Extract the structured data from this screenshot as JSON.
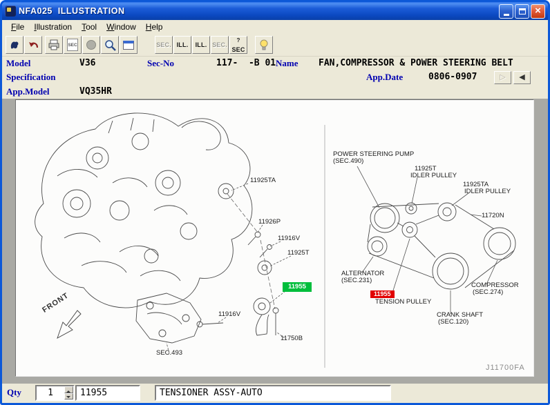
{
  "window": {
    "title": "NFA025  ILLUSTRATION"
  },
  "menu": {
    "items": [
      "File",
      "Illustration",
      "Tool",
      "Window",
      "Help"
    ]
  },
  "toolbar": {
    "sec_doc_label": "SEC",
    "sec_disabled_1": "SEC.",
    "ill_1": "ILL.",
    "ill_2": "ILL.",
    "sec_disabled_2": "SEC.",
    "sec_query_label": "SEC",
    "sec_query_badge": "?"
  },
  "info": {
    "model_label": "Model",
    "model_value": "V36",
    "secno_label": "Sec-No",
    "secno_value": "117-  -B 01",
    "name_label": "Name",
    "name_value": "FAN,COMPRESSOR & POWER STEERING BELT",
    "spec_label": "Specification",
    "appdate_label": "App.Date",
    "appdate_value": "0806-0907",
    "appmodel_label": "App.Model",
    "appmodel_value": "VQ35HR",
    "nav_next": "▷",
    "nav_prev": "◀"
  },
  "illustration": {
    "left": {
      "l1": "11925TA",
      "l2": "11926P",
      "l3": "11916V",
      "l4": "11925T",
      "hl": "11955",
      "l5": "11916V",
      "l6": "11750B",
      "l7": "SEC.493",
      "front": "FRONT"
    },
    "right": {
      "ps1": "POWER STEERING PUMP",
      "ps2": "(SEC.490)",
      "it1": "11925T",
      "it2": "IDLER PULLEY",
      "ita1": "11925TA",
      "ita2": "IDLER PULLEY",
      "belt": "11720N",
      "alt1": "ALTERNATOR",
      "alt2": "(SEC.231)",
      "tn": "11955",
      "tname": "TENSION PULLEY",
      "c1": "COMPRESSOR",
      "c2": "(SEC.274)",
      "cr1": "CRANK SHAFT",
      "cr2": "(SEC.120)"
    },
    "code": "J11700FA"
  },
  "bottom": {
    "qty_label": "Qty",
    "qty_value": "1",
    "part_no": "11955",
    "part_name": "TENSIONER ASSY-AUTO"
  }
}
